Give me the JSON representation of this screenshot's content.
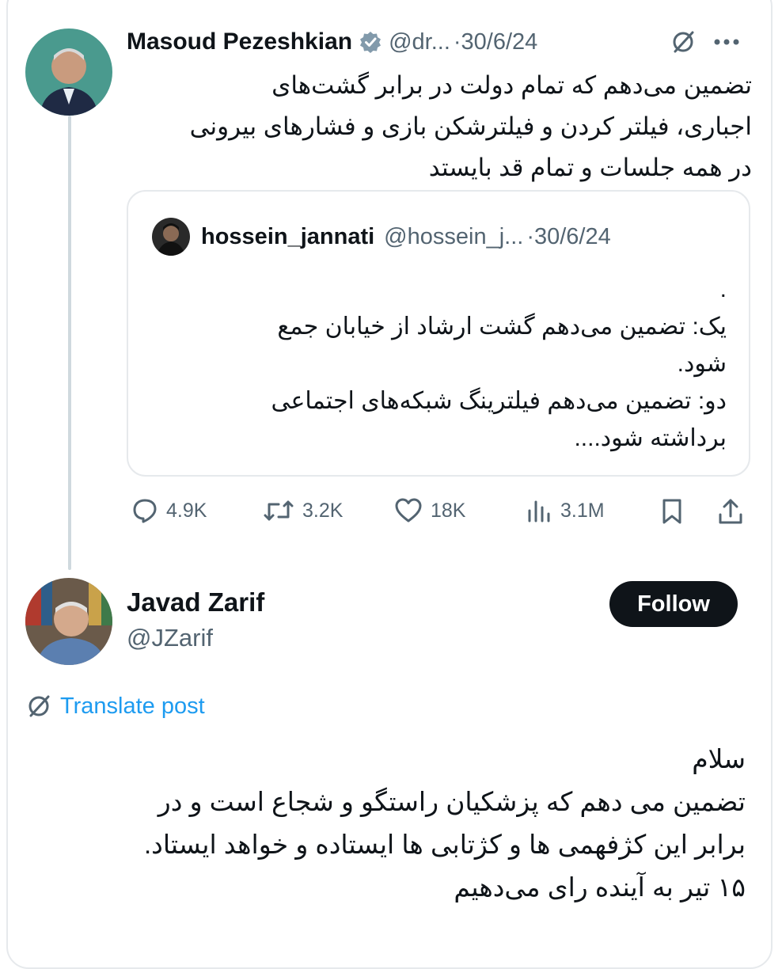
{
  "tweet": {
    "author_name": "Masoud Pezeshkian",
    "author_handle": "@dr...",
    "date": "·30/6/24",
    "text_lines": [
      "تضمین می‌دهم که تمام دولت در برابر  گشت‌های",
      "اجباری، فیلتر کردن و فیلترشکن بازی و فشارهای بیرونی",
      "در همه جلسات و تمام قد بایستد"
    ]
  },
  "quoted": {
    "author_name": "hossein_jannati",
    "author_handle": "@hossein_j...",
    "date": "·30/6/24",
    "text_lines": [
      ".",
      "یک: تضمین می‌دهم گشت ارشاد از خیابان جمع",
      "شود.",
      "دو: تضمین می‌دهم فیلترینگ شبکه‌های اجتماعی",
      "برداشته شود...."
    ]
  },
  "actions": {
    "replies": "4.9K",
    "reposts": "3.2K",
    "likes": "18K",
    "views": "3.1M"
  },
  "reply": {
    "author_name": "Javad Zarif",
    "author_handle": "@JZarif",
    "follow_label": "Follow",
    "translate_label": "Translate post",
    "text_lines": [
      "سلام",
      "تضمین می دهم که پزشکیان راستگو و شجاع است و  در",
      "برابر این کژفهمی ها و کژتابی ها ایستاده و خواهد ایستاد.",
      "۱۵ تیر به آینده رای می‌دهیم"
    ]
  },
  "colors": {
    "text": "#0f1419",
    "muted": "#536471",
    "link": "#1d9bf0",
    "verified": "#829aab",
    "border": "#e6e9ec",
    "follow_bg": "#0f1419"
  },
  "icons": [
    "verified-badge-icon",
    "grok-slash-icon",
    "more-icon",
    "reply-icon",
    "repost-icon",
    "like-icon",
    "views-icon",
    "bookmark-icon",
    "share-icon",
    "translate-icon"
  ]
}
